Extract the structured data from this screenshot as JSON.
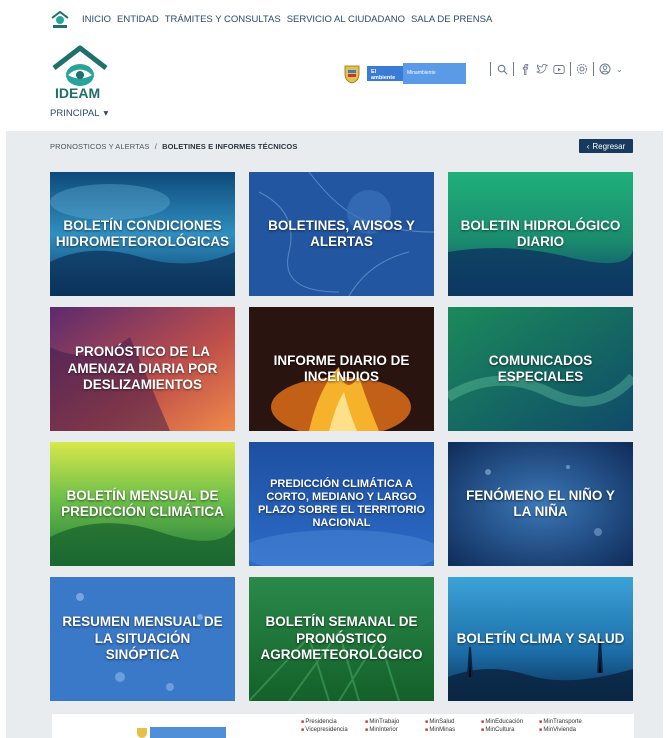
{
  "topnav": {
    "items": [
      "INICIO",
      "ENTIDAD",
      "TRÁMITES Y CONSULTAS",
      "SERVICIO AL CIUDADANO",
      "SALA DE PRENSA"
    ]
  },
  "brand": {
    "name": "IDEAM"
  },
  "menu": {
    "principal": "PRINCIPAL"
  },
  "gov_badge": {
    "line1": "El ambiente es de todos",
    "line2": "Minambiente"
  },
  "tools": [
    "search-icon",
    "facebook-icon",
    "twitter-icon",
    "youtube-icon",
    "settings-icon",
    "user-icon"
  ],
  "breadcrumb": {
    "parent": "PRONOSTICOS Y ALERTAS",
    "separator": "/",
    "current": "BOLETINES E INFORMES TÉCNICOS"
  },
  "back_button": {
    "label": "Regresar"
  },
  "cards": [
    {
      "label": "BOLETÍN CONDICIONES HIDROMETEOROLÓGICAS"
    },
    {
      "label": "BOLETINES, AVISOS Y ALERTAS"
    },
    {
      "label": "BOLETIN HIDROLÓGICO DIARIO"
    },
    {
      "label": "PRONÓSTICO DE LA AMENAZA DIARIA POR DESLIZAMIENTOS"
    },
    {
      "label": "INFORME DIARIO DE INCENDIOS"
    },
    {
      "label": "COMUNICADOS ESPECIALES"
    },
    {
      "label": "BOLETÍN MENSUAL DE PREDICCIÓN CLIMÁTICA"
    },
    {
      "label": "PREDICCIÓN CLIMÁTICA A CORTO, MEDIANO Y LARGO PLAZO SOBRE EL TERRITORIO NACIONAL"
    },
    {
      "label": "FENÓMENO EL NIÑO Y LA NIÑA"
    },
    {
      "label": "RESUMEN MENSUAL DE LA SITUACIÓN SINÓPTICA"
    },
    {
      "label": "BOLETÍN SEMANAL DE PRONÓSTICO AGROMETEOROLÓGICO"
    },
    {
      "label": "BOLETÍN CLIMA Y SALUD"
    }
  ],
  "footer": {
    "links": [
      "Presidencia",
      "MinTrabajo",
      "MinSalud",
      "MinEducación",
      "MinTransporte",
      "Vicepresidencia",
      "MinInterior",
      "MinMinas",
      "MinCultura",
      "MinVivienda"
    ]
  },
  "colors": {
    "accent": "#173a5e",
    "brand": "#1f6f6a",
    "background": "#e8ecef"
  }
}
